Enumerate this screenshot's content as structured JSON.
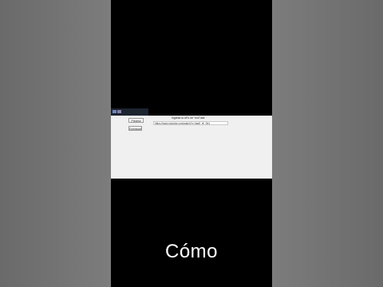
{
  "app": {
    "title": "Ingresa la URL de YouTube:",
    "url_value": "https://www.youtube.com/watch?v=Vag9_tK_0h4",
    "preview_button": "Preview",
    "download_button": "Download"
  },
  "caption": {
    "text": "Cómo"
  }
}
